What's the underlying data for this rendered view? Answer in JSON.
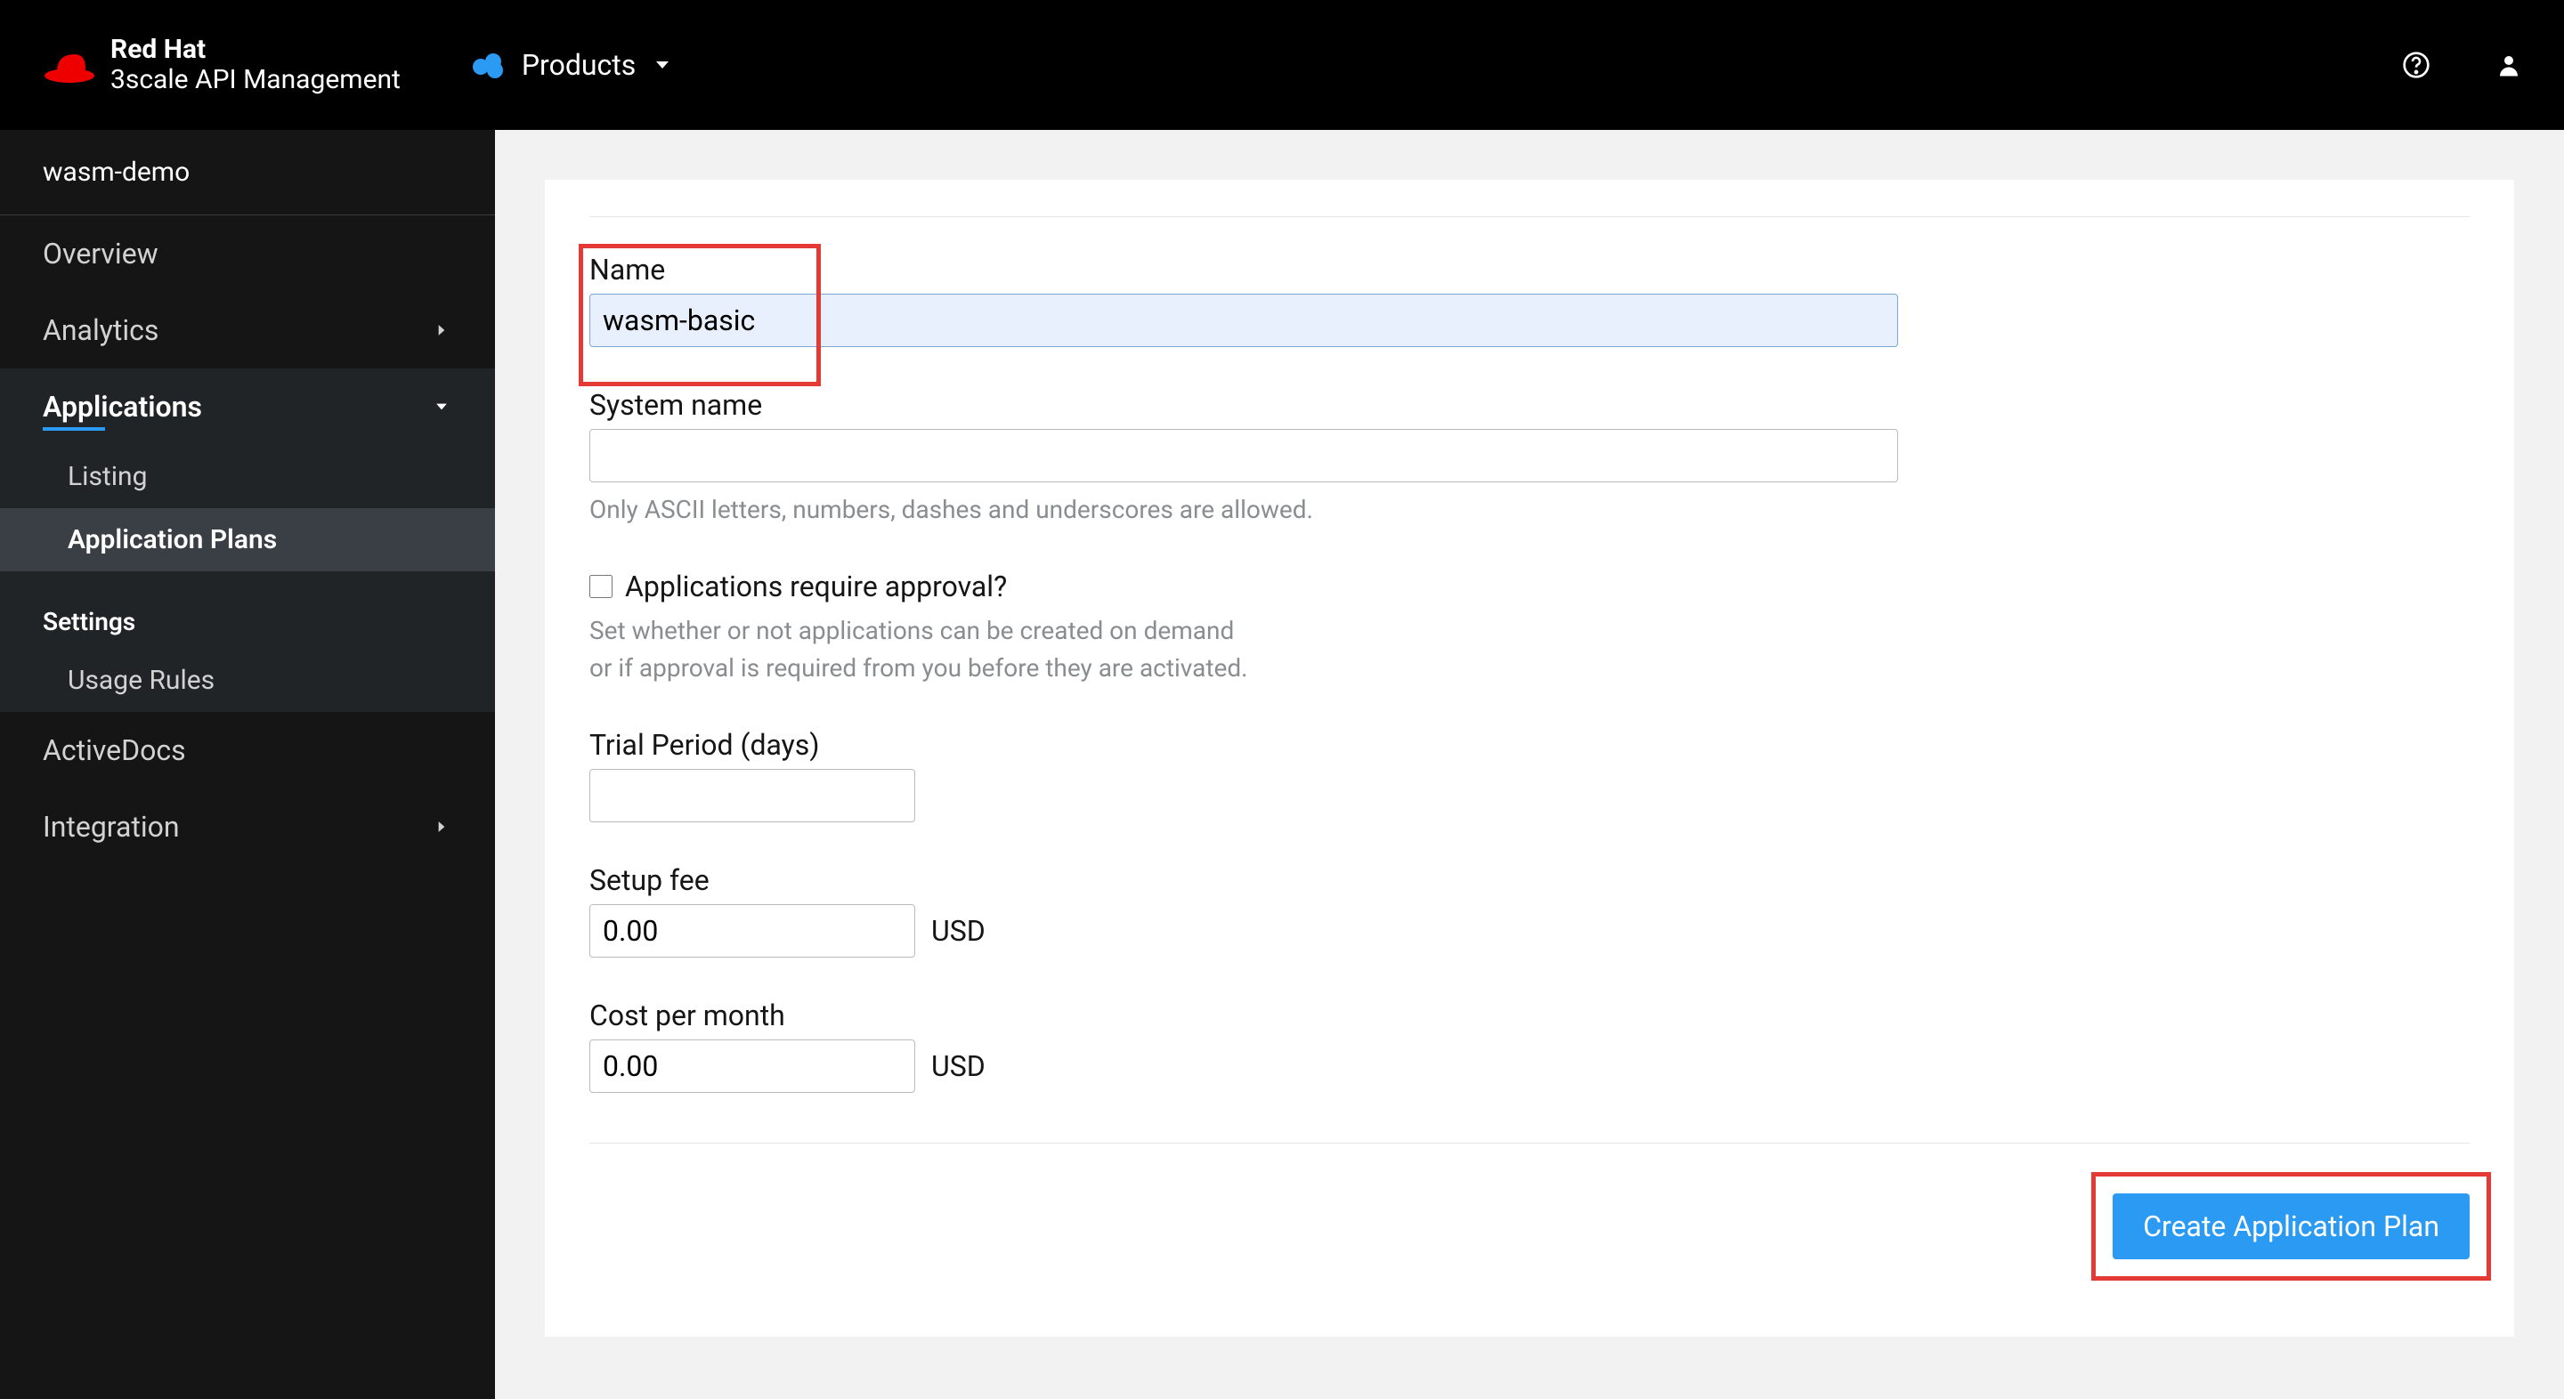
{
  "brand": {
    "line1": "Red Hat",
    "line2": "3scale API Management"
  },
  "header": {
    "products_label": "Products"
  },
  "sidebar": {
    "context_title": "wasm-demo",
    "items": [
      {
        "label": "Overview",
        "type": "link"
      },
      {
        "label": "Analytics",
        "type": "expandable"
      },
      {
        "label": "Applications",
        "type": "expanded",
        "sub": [
          {
            "label": "Listing"
          },
          {
            "label": "Application Plans",
            "active": true
          }
        ]
      },
      {
        "label": "Settings",
        "type": "section",
        "sub": [
          {
            "label": "Usage Rules"
          }
        ]
      },
      {
        "label": "ActiveDocs",
        "type": "link"
      },
      {
        "label": "Integration",
        "type": "expandable"
      }
    ]
  },
  "form": {
    "name_label": "Name",
    "name_value": "wasm-basic",
    "system_name_label": "System name",
    "system_name_value": "",
    "system_name_help": "Only ASCII letters, numbers, dashes and underscores are allowed.",
    "approval_label": "Applications require approval?",
    "approval_help_1": "Set whether or not applications can be created on demand",
    "approval_help_2": "or if approval is required from you before they are activated.",
    "trial_label": "Trial Period (days)",
    "trial_value": "",
    "setup_fee_label": "Setup fee",
    "setup_fee_value": "0.00",
    "cost_label": "Cost per month",
    "cost_value": "0.00",
    "currency": "USD",
    "submit_label": "Create Application Plan"
  }
}
